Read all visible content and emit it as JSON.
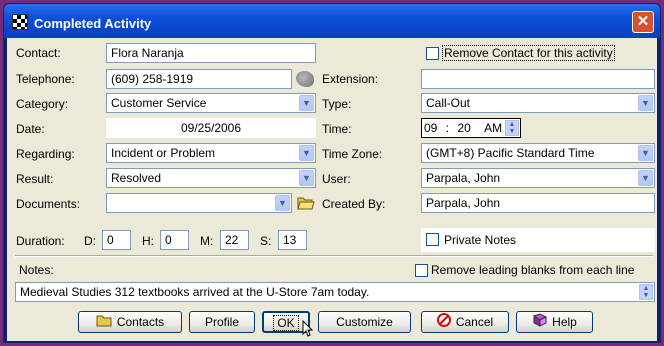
{
  "window": {
    "title": "Completed Activity",
    "close_symbol": "✕"
  },
  "labels": {
    "contact": "Contact:",
    "telephone": "Telephone:",
    "category": "Category:",
    "date": "Date:",
    "regarding": "Regarding:",
    "result": "Result:",
    "documents": "Documents:",
    "extension": "Extension:",
    "type": "Type:",
    "time": "Time:",
    "time_zone": "Time Zone:",
    "user": "User:",
    "created_by": "Created By:",
    "duration": "Duration:",
    "dur_d": "D:",
    "dur_h": "H:",
    "dur_m": "M:",
    "dur_s": "S:",
    "notes": "Notes:"
  },
  "fields": {
    "contact": "Flora Naranja",
    "remove_contact": "Remove Contact for this activity",
    "telephone": "(609) 258-1919",
    "extension": "",
    "category": "Customer Service",
    "type": "Call-Out",
    "date": "09/25/2006",
    "time_hour": "09",
    "time_sep": ":",
    "time_min": "20",
    "time_ampm": "AM",
    "regarding": "Incident or Problem",
    "time_zone": "(GMT+8) Pacific Standard Time",
    "result": "Resolved",
    "user": "Parpala, John",
    "documents": "",
    "created_by": "Parpala, John",
    "duration_d": "0",
    "duration_h": "0",
    "duration_m": "22",
    "duration_s": "13",
    "private_notes": "Private Notes",
    "remove_blanks": "Remove leading blanks from each line",
    "notes": "Medieval Studies 312 textbooks arrived at the U-Store 7am today."
  },
  "buttons": {
    "contacts": "Contacts",
    "profile": "Profile",
    "ok": "OK",
    "customize": "Customize",
    "cancel": "Cancel",
    "help": "Help"
  },
  "icons": {
    "window": "checkered-flag-icon",
    "dial": "phone-dial-icon",
    "folder": "open-folder-icon",
    "contacts": "folder-icon",
    "cancel": "no-entry-icon",
    "help": "book-icon"
  },
  "colors": {
    "titlebar": "#0b4fd8",
    "dialog_bg": "#ece9d8",
    "close": "#d8512c",
    "desktop": "#7a2a7c"
  }
}
